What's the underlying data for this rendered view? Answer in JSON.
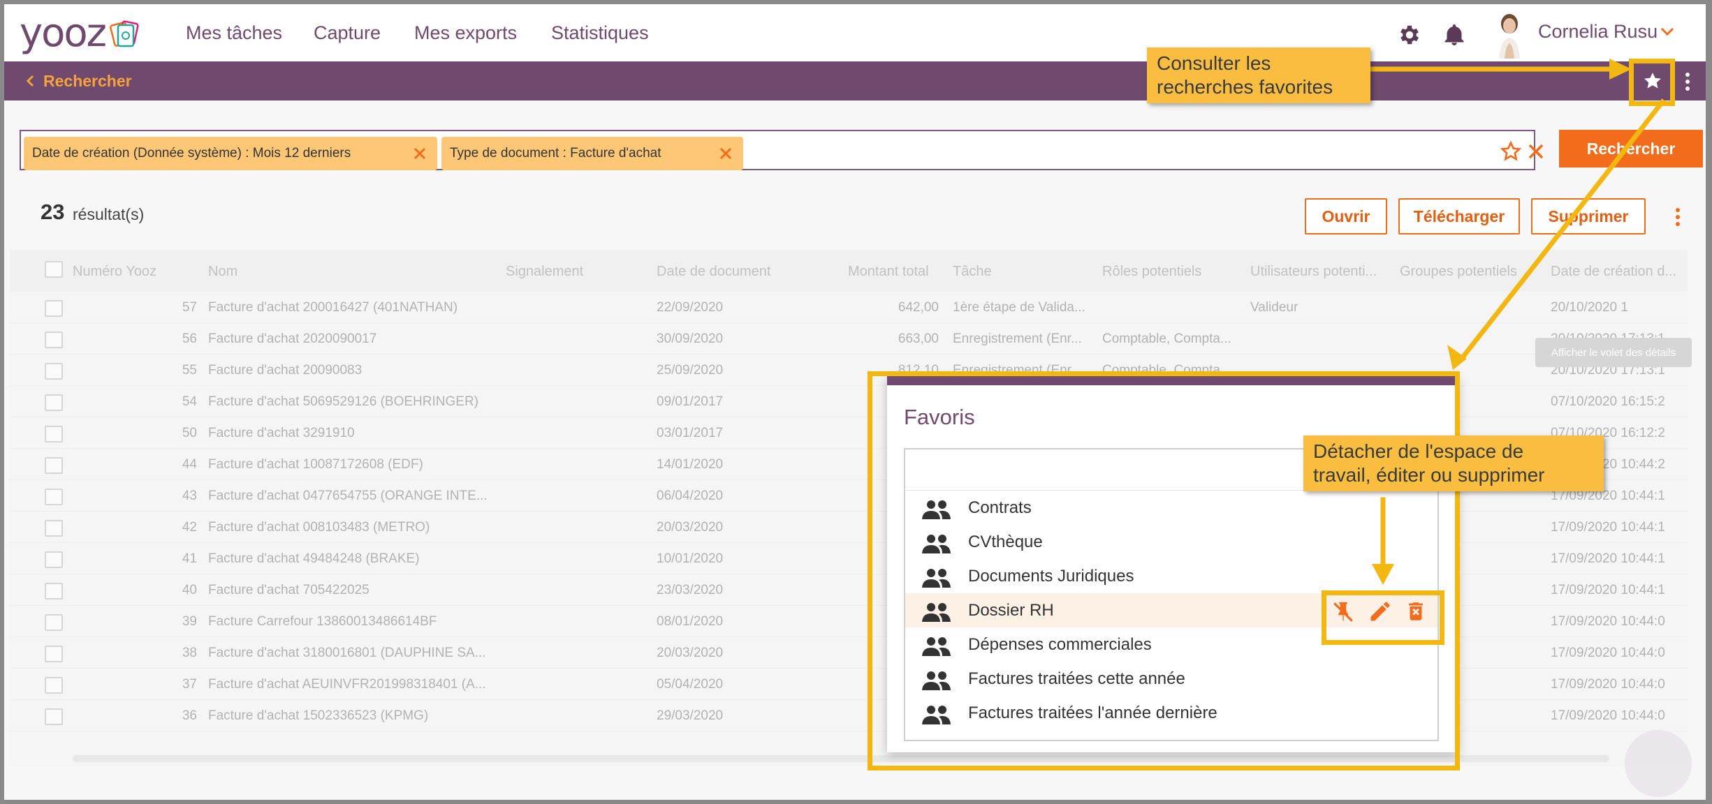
{
  "header": {
    "logo_text": "yooz",
    "nav": [
      "Mes tâches",
      "Capture",
      "Mes exports",
      "Statistiques"
    ],
    "user_name": "Cornelia Rusu",
    "icons": [
      "gear-icon",
      "bell-icon",
      "chevron-down-icon"
    ]
  },
  "subbar": {
    "back_label": "Rechercher",
    "icons": [
      "chevron-left-icon",
      "star-icon",
      "more-vertical-icon"
    ]
  },
  "filters": {
    "chips": [
      "Date de création (Donnée système) : Mois 12 derniers",
      "Type de document : Facture d'achat"
    ],
    "search_button": "Rechercher"
  },
  "results": {
    "count": "23",
    "count_label": "résultat(s)",
    "actions": [
      "Ouvrir",
      "Télécharger",
      "Supprimer"
    ]
  },
  "table": {
    "columns": [
      "Numéro Yooz",
      "Nom",
      "Signalement",
      "Date de document",
      "Montant total",
      "Tâche",
      "Rôles potentiels",
      "Utilisateurs potenti...",
      "Groupes potentiels",
      "Date de création d..."
    ],
    "rows": [
      {
        "num": "57",
        "nom": "Facture d'achat 200016427 (401NATHAN)",
        "date": "22/09/2020",
        "montant": "642,00",
        "tache": "1ère étape de Valida...",
        "roles": "",
        "users": "Valideur",
        "created": "20/10/2020 1"
      },
      {
        "num": "56",
        "nom": "Facture d'achat 2020090017",
        "date": "30/09/2020",
        "montant": "663,00",
        "tache": "Enregistrement (Enr...",
        "roles": "Comptable, Compta...",
        "users": "",
        "created": "20/10/2020 17:13:1"
      },
      {
        "num": "55",
        "nom": "Facture d'achat 20090083",
        "date": "25/09/2020",
        "montant": "812,10",
        "tache": "Enregistrement (Enr...",
        "roles": "Comptable, Compta...",
        "users": "",
        "created": "20/10/2020 17:13:1"
      },
      {
        "num": "54",
        "nom": "Facture d'achat 5069529126 (BOEHRINGER)",
        "date": "09/01/2017",
        "montant": "",
        "tache": "",
        "roles": "",
        "users": "",
        "created": "07/10/2020 16:15:2"
      },
      {
        "num": "50",
        "nom": "Facture d'achat 3291910",
        "date": "03/01/2017",
        "montant": "",
        "tache": "",
        "roles": "",
        "users": "",
        "created": "07/10/2020 16:12:2"
      },
      {
        "num": "44",
        "nom": "Facture d'achat 10087172608 (EDF)",
        "date": "14/01/2020",
        "montant": "",
        "tache": "",
        "roles": "",
        "users": "",
        "created": "17/09/2020 10:44:2"
      },
      {
        "num": "43",
        "nom": "Facture d'achat 0477654755 (ORANGE INTE...",
        "date": "06/04/2020",
        "montant": "",
        "tache": "",
        "roles": "",
        "users": "",
        "created": "17/09/2020 10:44:1"
      },
      {
        "num": "42",
        "nom": "Facture d'achat 008103483 (METRO)",
        "date": "20/03/2020",
        "montant": "",
        "tache": "",
        "roles": "",
        "users": "",
        "created": "17/09/2020 10:44:1"
      },
      {
        "num": "41",
        "nom": "Facture d'achat 49484248 (BRAKE)",
        "date": "10/01/2020",
        "montant": "",
        "tache": "",
        "roles": "",
        "users": "",
        "created": "17/09/2020 10:44:1"
      },
      {
        "num": "40",
        "nom": "Facture d'achat 705422025",
        "date": "23/03/2020",
        "montant": "",
        "tache": "",
        "roles": "",
        "users": "",
        "created": "17/09/2020 10:44:1"
      },
      {
        "num": "39",
        "nom": "Facture Carrefour 13860013486614BF",
        "date": "08/01/2020",
        "montant": "",
        "tache": "",
        "roles": "",
        "users": "",
        "created": "17/09/2020 10:44:0"
      },
      {
        "num": "38",
        "nom": "Facture d'achat 3180016801 (DAUPHINE SA...",
        "date": "20/03/2020",
        "montant": "",
        "tache": "",
        "roles": "",
        "users": "",
        "created": "17/09/2020 10:44:0"
      },
      {
        "num": "37",
        "nom": "Facture d'achat AEUINVFR201998318401 (A...",
        "date": "05/04/2020",
        "montant": "",
        "tache": "",
        "roles": "",
        "users": "",
        "created": "17/09/2020 10:44:0"
      },
      {
        "num": "36",
        "nom": "Facture d'achat 1502336523 (KPMG)",
        "date": "29/03/2020",
        "montant": "",
        "tache": "",
        "roles": "",
        "users": "",
        "created": "17/09/2020 10:44:0"
      }
    ]
  },
  "details_tooltip": "Afficher le volet des détails",
  "favorites": {
    "title": "Favoris",
    "items": [
      "Contrats",
      "CVthèque",
      "Documents Juridiques",
      "Dossier RH",
      "Dépenses commerciales",
      "Factures traitées cette année",
      "Factures traitées l'année dernière"
    ],
    "active_index": 3,
    "item_actions": [
      "unpin-icon",
      "pencil-icon",
      "trash-icon"
    ]
  },
  "callouts": {
    "favorites_hint": [
      "Consulter les",
      "recherches favorites"
    ],
    "actions_hint": [
      "Détacher de l'espace de",
      "travail, éditer ou supprimer"
    ]
  },
  "colors": {
    "brand_purple": "#6f4a6e",
    "accent_orange": "#f36c1b",
    "chip_yellow": "#fdc776",
    "callout_yellow": "#f9bd3f",
    "highlight_border": "#f3b712"
  }
}
